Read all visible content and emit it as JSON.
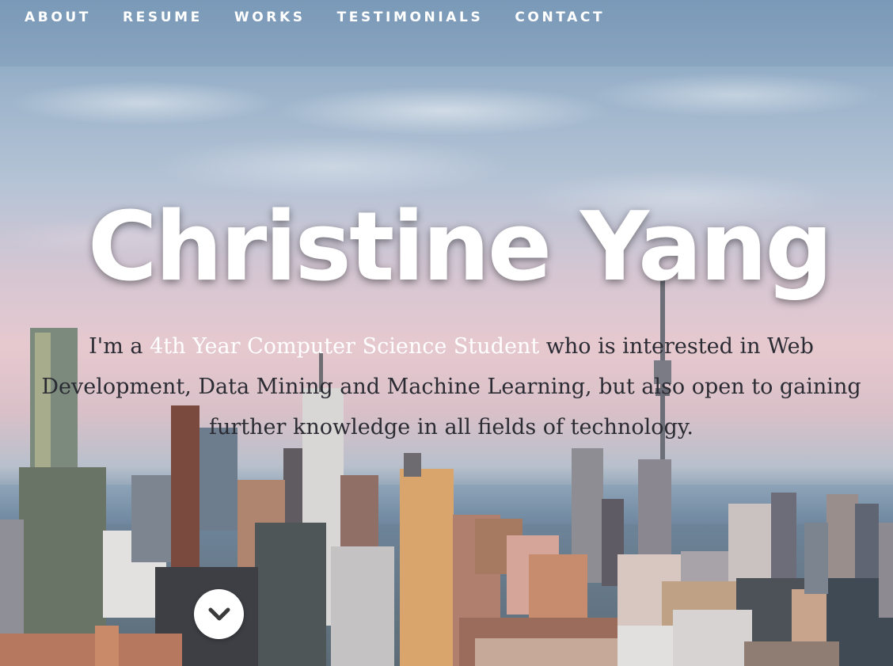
{
  "nav": {
    "items": [
      {
        "label": "ABOUT"
      },
      {
        "label": "RESUME"
      },
      {
        "label": "WORKS"
      },
      {
        "label": "TESTIMONIALS"
      },
      {
        "label": "CONTACT"
      }
    ]
  },
  "hero": {
    "name": "Christine Yang",
    "intro_prefix": "I'm a",
    "intro_highlight": "4th Year Computer Science Student",
    "intro_suffix": "who is interested in Web Development, Data Mining and Machine Learning, but also open to gaining further knowledge in all fields of technology.",
    "scroll_icon": "chevron-down-icon"
  },
  "colors": {
    "nav_text": "#ffffff",
    "title": "#ffffff",
    "intro_text": "#2b2b33",
    "highlight": "#ffffff"
  }
}
